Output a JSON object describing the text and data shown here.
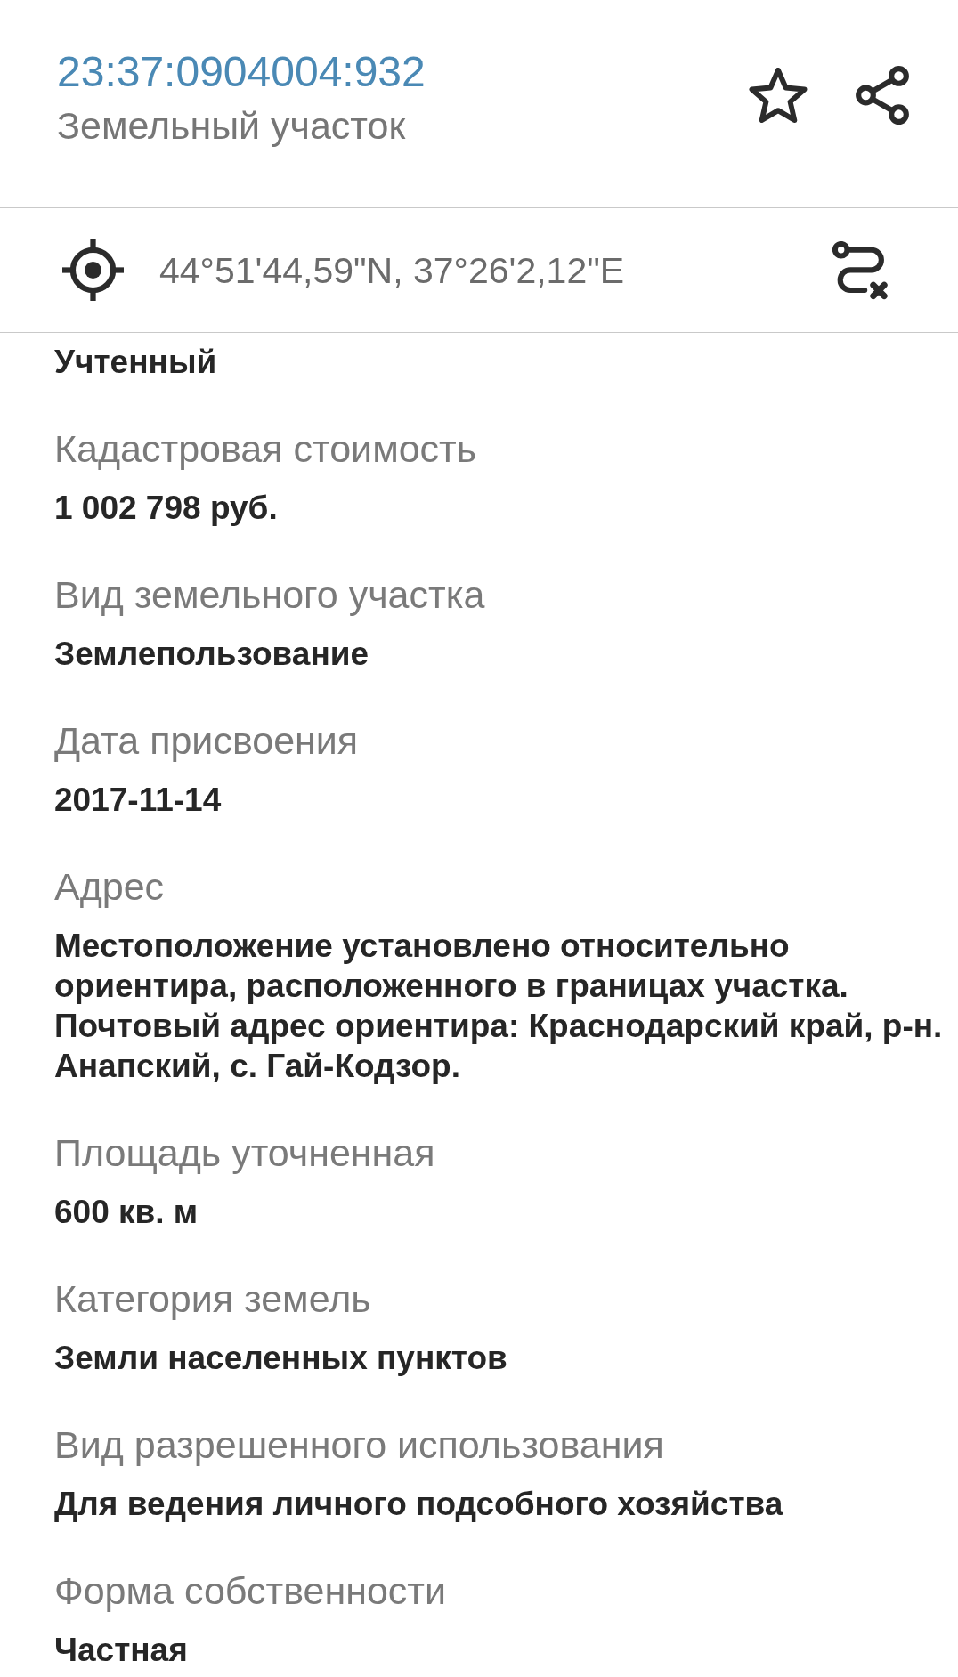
{
  "header": {
    "cadastral_number": "23:37:0904004:932",
    "object_type": "Земельный участок",
    "favorite": false
  },
  "location": {
    "coordinates": "44°51'44,59\"N, 37°26'2,12\"E"
  },
  "fields": [
    {
      "value": "Учтенный"
    },
    {
      "label": "Кадастровая стоимость",
      "value": "1 002 798 руб."
    },
    {
      "label": "Вид земельного участка",
      "value": "Землепользование"
    },
    {
      "label": "Дата присвоения",
      "value": "2017-11-14"
    },
    {
      "label": "Адрес",
      "value": "Местоположение установлено относительно ориентира, расположенного в границах участка. Почтовый адрес ориентира: Краснодарский край, р-н. Анапский, с. Гай-Кодзор."
    },
    {
      "label": "Площадь уточненная",
      "value": "600 кв. м"
    },
    {
      "label": "Категория земель",
      "value": "Земли населенных пунктов"
    },
    {
      "label": "Вид разрешенного использования",
      "value": "Для ведения личного подсобного хозяйства"
    },
    {
      "label": "Форма собственности",
      "value": "Частная"
    }
  ]
}
